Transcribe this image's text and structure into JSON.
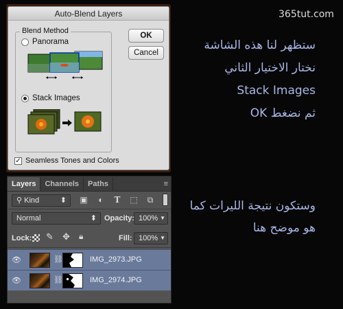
{
  "watermark": "365tut.com",
  "dialog": {
    "title": "Auto-Blend Layers",
    "blend_method_label": "Blend Method",
    "option_panorama": "Panorama",
    "option_stack_images": "Stack Images",
    "selected_option": "Stack Images",
    "ok_label": "OK",
    "cancel_label": "Cancel",
    "seamless_label": "Seamless Tones and Colors",
    "seamless_checked": true
  },
  "instructions": {
    "line1": "ستظهر لنا هذه الشاشة",
    "line2": "نختار الاختيار الثاني",
    "line3": "Stack Images",
    "line4": "ثم نضغط OK",
    "line5": "وستكون نتيجة الليرات كما",
    "line6": "هو موضح هنا"
  },
  "layers_panel": {
    "tabs": [
      "Layers",
      "Channels",
      "Paths"
    ],
    "active_tab": "Layers",
    "filter_kind": "Kind",
    "blend_mode": "Normal",
    "opacity_label": "Opacity:",
    "opacity_value": "100%",
    "lock_label": "Lock:",
    "fill_label": "Fill:",
    "fill_value": "100%",
    "layers": [
      {
        "name": "IMG_2973.JPG",
        "visible": true
      },
      {
        "name": "IMG_2974.JPG",
        "visible": true
      }
    ]
  },
  "colors": {
    "instruction_text": "#a9b6e6",
    "selected_layer": "#6a7a9b",
    "panel_bg": "#535353"
  }
}
